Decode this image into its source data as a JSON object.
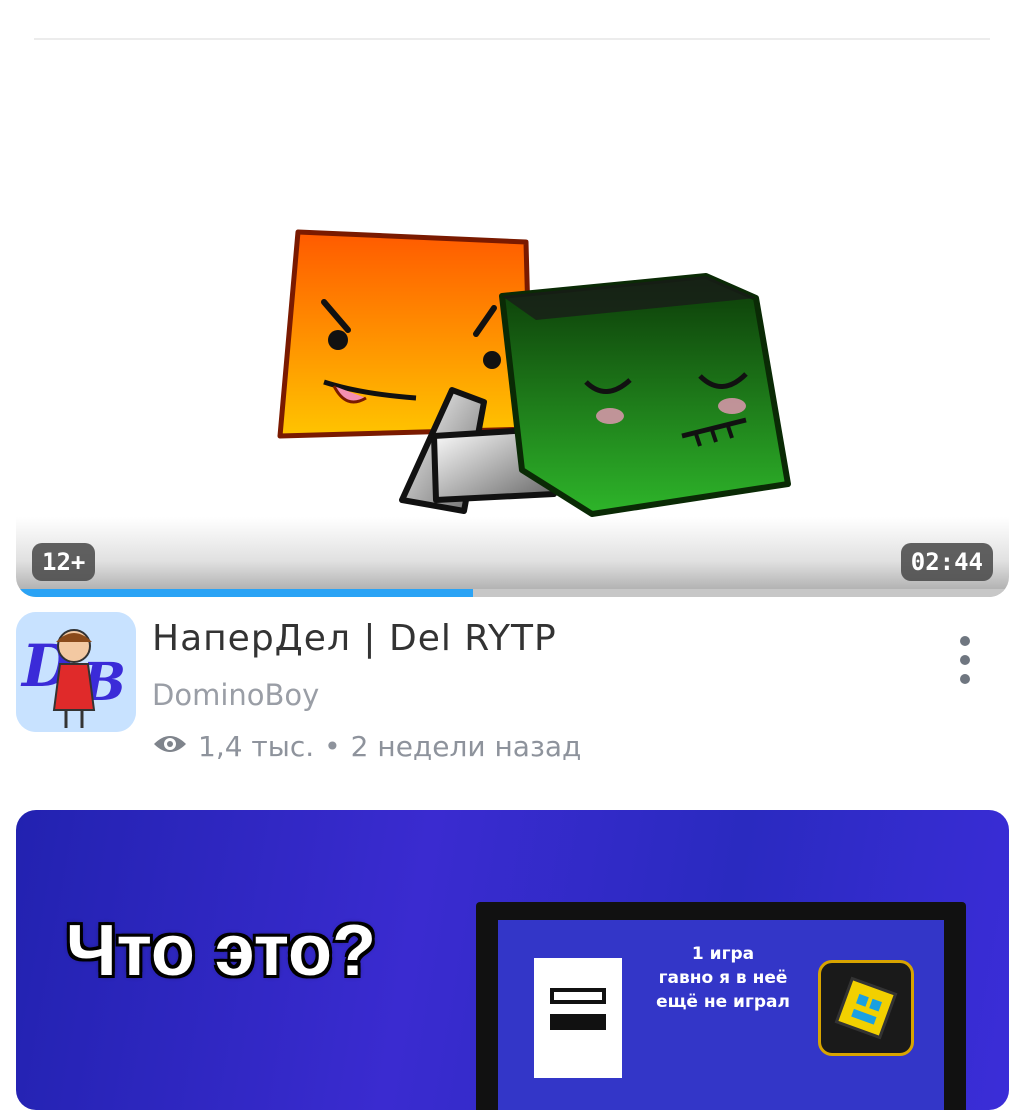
{
  "video1": {
    "age_rating": "12+",
    "duration": "02:44",
    "watch_progress": 0.46,
    "title": "НаперДел | Del RYTP",
    "channel": "DominoBoy",
    "views": "1,4 тыс.",
    "separator": "•",
    "age": "2 недели назад",
    "avatar_text": "DB"
  },
  "video2": {
    "thumbnail_title": "Что это?",
    "screen_text_line1": "1 игра",
    "screen_text_line2": "гавно я в неё",
    "screen_text_line3": "ещё не играл"
  },
  "colors": {
    "progress": "#2aa3f5",
    "thumb2_bg": "#3a2bd0"
  }
}
